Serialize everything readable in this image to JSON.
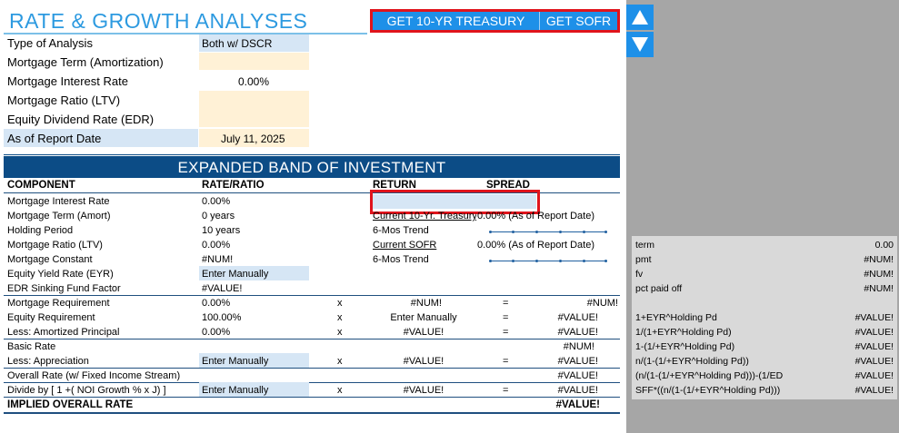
{
  "title": "RATE & GROWTH ANALYSES",
  "buttons": {
    "treasury": "GET 10-YR TREASURY",
    "sofr": "GET SOFR"
  },
  "inputs": [
    {
      "label": "Type of Analysis",
      "value": "Both w/ DSCR"
    },
    {
      "label": "Mortgage Term (Amortization)",
      "value": ""
    },
    {
      "label": "Mortgage Interest Rate",
      "value": "0.00%"
    },
    {
      "label": "Mortgage Ratio (LTV)",
      "value": ""
    },
    {
      "label": "Equity Dividend Rate (EDR)",
      "value": ""
    },
    {
      "label": "As of Report Date",
      "value": "July 11, 2025"
    }
  ],
  "band": {
    "title": "EXPANDED BAND OF INVESTMENT"
  },
  "headers": {
    "component": "COMPONENT",
    "rate": "RATE/RATIO",
    "return": "RETURN",
    "spread": "SPREAD"
  },
  "rows": {
    "mir": {
      "label": "Mortgage Interest Rate",
      "rate": "0.00%"
    },
    "mta": {
      "label": "Mortgage Term (Amort)",
      "rate": "0 years",
      "sub": "Current 10-Yr. Treasury",
      "subval": "0.00% (As of Report Date)"
    },
    "hp": {
      "label": "Holding Period",
      "rate": "10 years",
      "sub": "6-Mos Trend"
    },
    "ltv": {
      "label": "Mortgage Ratio (LTV)",
      "rate": "0.00%",
      "sub": "Current SOFR",
      "subval": "0.00% (As of Report Date)"
    },
    "mc": {
      "label": "Mortgage Constant",
      "rate": "#NUM!",
      "sub": "6-Mos Trend"
    },
    "eyr": {
      "label": "Equity Yield Rate (EYR)",
      "rate": "Enter Manually"
    },
    "edr": {
      "label": "EDR Sinking Fund Factor",
      "rate": "#VALUE!"
    },
    "mreq": {
      "label": "Mortgage Requirement",
      "rate": "0.00%",
      "x": "x",
      "ret": "#NUM!",
      "eq": "=",
      "res": "#NUM!"
    },
    "ereq": {
      "label": "Equity Requirement",
      "rate": "100.00%",
      "x": "x",
      "ret": "Enter Manually",
      "eq": "=",
      "res": "#VALUE!"
    },
    "lap": {
      "label": "Less: Amortized Principal",
      "rate": "0.00%",
      "x": "x",
      "ret": "#VALUE!",
      "eq": "=",
      "res": "#VALUE!"
    },
    "basic": {
      "label": "Basic Rate",
      "res": "#NUM!"
    },
    "lapp": {
      "label": "Less: Appreciation",
      "rate": "Enter Manually",
      "x": "x",
      "ret": "#VALUE!",
      "eq": "=",
      "res": "#VALUE!"
    },
    "orf": {
      "label": "Overall Rate (w/ Fixed Income Stream)",
      "res": "#VALUE!"
    },
    "div": {
      "label": "Divide by [ 1 +( NOI Growth % x J) ]",
      "rate": "Enter Manually",
      "x": "x",
      "ret": "#VALUE!",
      "eq": "=",
      "res": "#VALUE!"
    },
    "ior": {
      "label": "IMPLIED OVERALL RATE",
      "res": "#VALUE!"
    }
  },
  "panel": [
    {
      "label": "term",
      "value": "0.00"
    },
    {
      "label": "pmt",
      "value": "#NUM!"
    },
    {
      "label": "fv",
      "value": "#NUM!"
    },
    {
      "label": "pct paid off",
      "value": "#NUM!"
    },
    {
      "label": "1+EYR^Holding Pd",
      "value": "#VALUE!"
    },
    {
      "label": "1/(1+EYR^Holding Pd)",
      "value": "#VALUE!"
    },
    {
      "label": "1-(1/+EYR^Holding Pd)",
      "value": "#VALUE!"
    },
    {
      "label": "n/(1-(1/+EYR^Holding Pd))",
      "value": "#VALUE!"
    },
    {
      "label": "(n/(1-(1/+EYR^Holding Pd)))-(1/ED",
      "value": "#VALUE!"
    },
    {
      "label": "SFF*((n/(1-(1/+EYR^Holding Pd)))",
      "value": "#VALUE!"
    }
  ]
}
